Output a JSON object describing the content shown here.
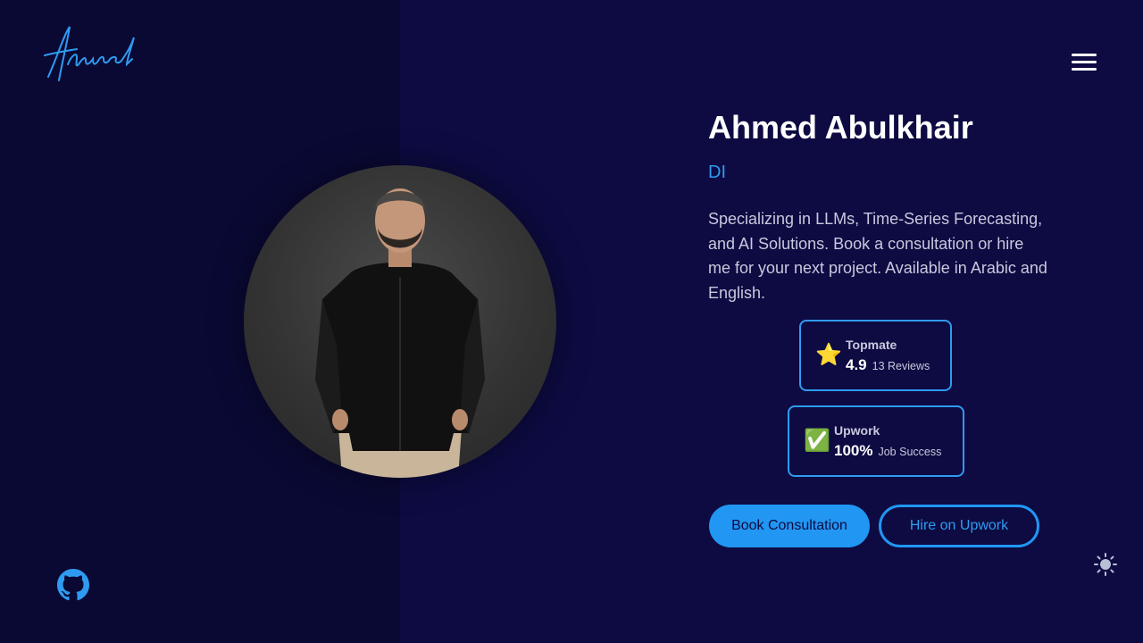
{
  "header": {
    "logo_text": "Ahmed",
    "menu_icon": "hamburger-menu-icon"
  },
  "profile": {
    "name": "Ahmed Abulkhair",
    "role": "DI",
    "description": "Specializing in LLMs, Time-Series Forecasting, and AI Solutions. Book a consultation or hire me for your next project. Available in Arabic and English."
  },
  "badges": [
    {
      "icon": "star-icon",
      "icon_glyph": "⭐",
      "title": "Topmate",
      "value": "4.9",
      "sub": "13 Reviews"
    },
    {
      "icon": "check-icon",
      "icon_glyph": "✅",
      "title": "Upwork",
      "value": "100%",
      "sub": "Job Success"
    }
  ],
  "buttons": {
    "book_label": "Book Consultation",
    "hire_label": "Hire on Upwork"
  },
  "footer": {
    "github_icon": "github-icon",
    "theme_icon": "sun-icon"
  },
  "colors": {
    "background": "#0d0b42",
    "left_panel": "#0a0934",
    "accent": "#2196f3",
    "accent_text": "#2f9bf0"
  }
}
